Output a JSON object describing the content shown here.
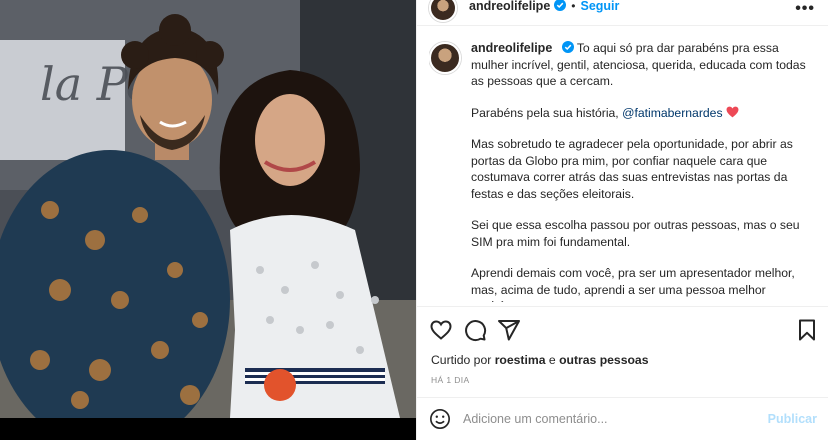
{
  "post": {
    "username": "andreolifelipe",
    "follow_label": "Seguir",
    "separator": "•",
    "more_label": "•••"
  },
  "photo": {
    "sign_text": "la Pen"
  },
  "caption": {
    "username": "andreolifelipe",
    "p1": "To aqui só pra dar parabéns pra essa mulher incrível, gentil, atenciosa, querida, educada com todas as pessoas que a cercam.",
    "p2_before": "Parabéns pela sua história, ",
    "p2_mention": "@fatimabernardes",
    "p3": "Mas sobretudo te agradecer pela oportunidade, por abrir as portas da Globo pra mim, por confiar naquele cara que costumava correr atrás das suas entrevistas nas portas da festas e das seções eleitorais.",
    "p4": "Sei que essa escolha passou por outras pessoas, mas o seu SIM pra mim foi fundamental.",
    "p5": "Aprendi demais com você, pra ser um apresentador melhor, mas, acima de tudo, aprendi a ser uma pessoa melhor também."
  },
  "likes": {
    "prefix": "Curtido por ",
    "user": "roestima",
    "middle": " e ",
    "others": "outras pessoas"
  },
  "timestamp": "HÁ 1 DIA",
  "comment": {
    "placeholder": "Adicione um comentário...",
    "publish_label": "Publicar"
  },
  "colors": {
    "verified": "#0095f6",
    "heart": "#ed4956",
    "publish_disabled": "#b2dffc",
    "link": "#00376b"
  }
}
